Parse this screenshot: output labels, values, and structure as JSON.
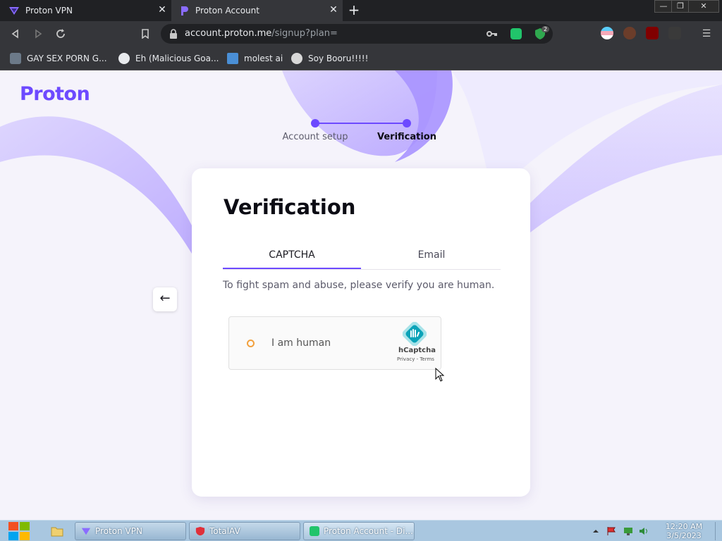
{
  "browser": {
    "tabs": [
      {
        "title": "Proton VPN"
      },
      {
        "title": "Proton Account"
      }
    ],
    "address": {
      "host": "account.proton.me",
      "path": "/signup?plan="
    },
    "bookmarks": [
      {
        "label": "GAY SEX PORN G..."
      },
      {
        "label": "Eh (Malicious Goa..."
      },
      {
        "label": "molest ai"
      },
      {
        "label": "Soy Booru!!!!!"
      }
    ],
    "shield_badge": "2",
    "window_controls": {
      "minimize": "—",
      "restore": "❐",
      "close": "✕"
    }
  },
  "page": {
    "logo": "Proton",
    "steps": [
      {
        "label": "Account setup",
        "done": true
      },
      {
        "label": "Verification",
        "current": true
      }
    ],
    "card": {
      "title": "Verification",
      "tabs": [
        {
          "label": "CAPTCHA",
          "active": true
        },
        {
          "label": "Email",
          "active": false
        }
      ],
      "description": "To fight spam and abuse, please verify you are human.",
      "captcha": {
        "label": "I am human",
        "brand": "hCaptcha",
        "links": "Privacy - Terms"
      }
    },
    "back_arrow": "←"
  },
  "taskbar": {
    "apps": [
      {
        "label": "Proton VPN"
      },
      {
        "label": "TotalAV"
      },
      {
        "label": "Proton Account - Di..."
      }
    ],
    "clock": {
      "time": "12:20 AM",
      "date": "3/5/2023"
    }
  },
  "colors": {
    "accent": "#6d4aff",
    "page_bg": "#f5f3fb",
    "chrome_dark": "#202124",
    "chrome_toolbar": "#35363a",
    "captcha_check": "#f2a03d",
    "taskbar": "#a9c7e0"
  }
}
